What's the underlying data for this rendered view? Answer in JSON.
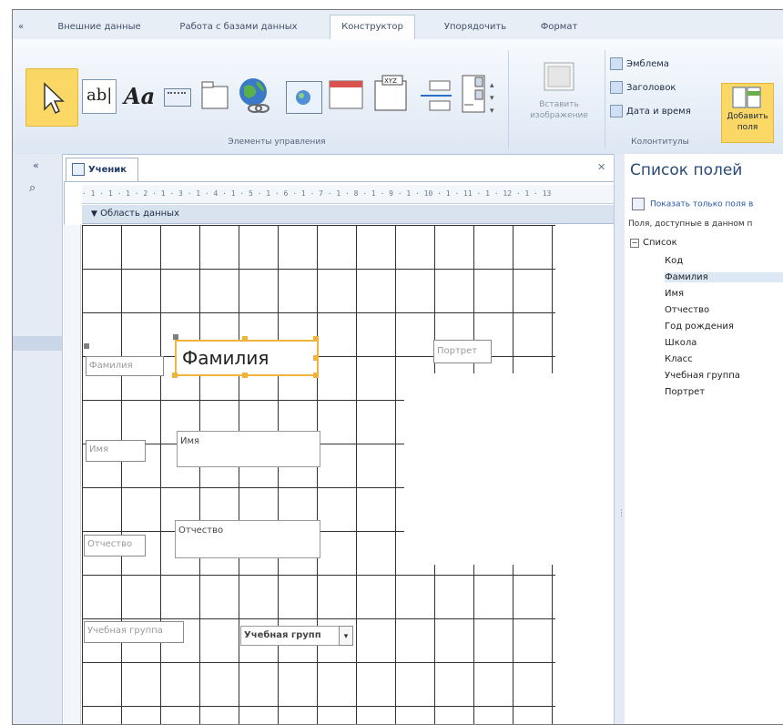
{
  "ribbon": {
    "tabs": [
      {
        "label": "Внешние данные",
        "active": false
      },
      {
        "label": "Работа с базами данных",
        "active": false
      },
      {
        "label": "Конструктор",
        "active": true
      },
      {
        "label": "Упорядочить",
        "active": false
      },
      {
        "label": "Формат",
        "active": false
      }
    ],
    "controls_group_caption": "Элементы управления",
    "insert_image": "Вставить изображение",
    "header_footer": {
      "items": [
        "Эмблема",
        "Заголовок",
        "Дата и время"
      ],
      "caption": "Колонтитулы"
    },
    "add_fields": "Добавить поля",
    "tools": [
      "pointer-icon",
      "textbox-icon",
      "label-icon",
      "button-icon",
      "tab-control-icon",
      "hyperlink-icon",
      "web-browser-icon",
      "navigation-icon",
      "option-group-icon",
      "page-break-icon",
      "combo-box-icon"
    ]
  },
  "document": {
    "tab_label": "Ученик",
    "section_header": "Область данных",
    "ruler_marks": "· 1 · 1 · 1 · 2 · 1 · 3 · 1 · 4 · 1 · 5 · 1 · 6 · 1 · 7 · 1 · 8 · 1 · 9 · 1 · 10 · 1 · 11 · 1 · 12 · 1 · 13"
  },
  "form": {
    "surname_label": "Фамилия",
    "surname_field": "Фамилия",
    "portrait_label": "Портрет",
    "name_label": "Имя",
    "name_field": "Имя",
    "patronymic_label": "Отчество",
    "patronymic_field": "Отчество",
    "study_group_label": "Учебная группа",
    "study_group_combo": "Учебная групп"
  },
  "field_list": {
    "title": "Список полей",
    "show_only_link": "Показать только поля в",
    "available_text": "Поля, доступные в данном п",
    "group": "Список",
    "fields": [
      "Код",
      "Фамилия",
      "Имя",
      "Отчество",
      "Год рождения",
      "Школа",
      "Класс",
      "Учебная группа",
      "Портрет"
    ],
    "highlighted": "Фамилия"
  },
  "colors": {
    "accent_selection": "#f0b33c",
    "ribbon_active_button": "#fbd866"
  }
}
